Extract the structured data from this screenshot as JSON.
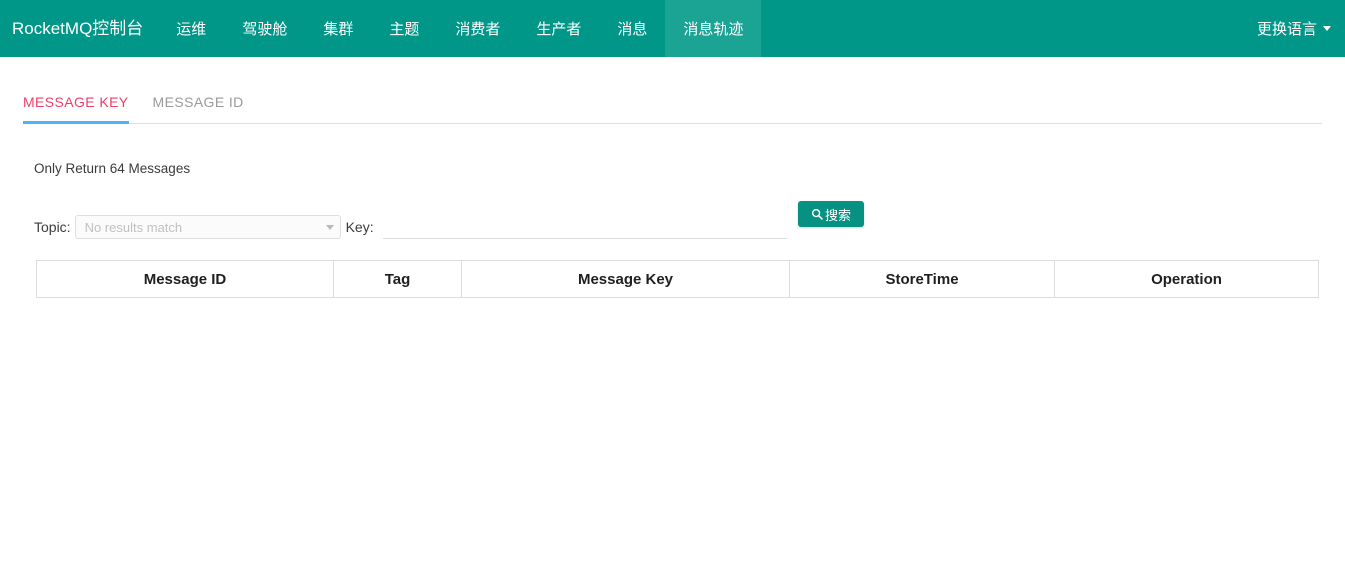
{
  "navbar": {
    "brand": "RocketMQ控制台",
    "items": [
      {
        "label": "运维",
        "active": false
      },
      {
        "label": "驾驶舱",
        "active": false
      },
      {
        "label": "集群",
        "active": false
      },
      {
        "label": "主题",
        "active": false
      },
      {
        "label": "消费者",
        "active": false
      },
      {
        "label": "生产者",
        "active": false
      },
      {
        "label": "消息",
        "active": false
      },
      {
        "label": "消息轨迹",
        "active": true
      }
    ],
    "language_label": "更换语言",
    "background_color": "#009688",
    "active_background_color": "#1ba394"
  },
  "tabs": [
    {
      "label": "MESSAGE KEY",
      "active": true
    },
    {
      "label": "MESSAGE ID",
      "active": false
    }
  ],
  "tab_active_color": "#ef3d68",
  "tab_underline_color": "#4bb4f5",
  "notice": "Only Return 64 Messages",
  "form": {
    "topic_label": "Topic:",
    "topic_value": "",
    "topic_placeholder": "No results match",
    "key_label": "Key:",
    "key_value": "",
    "key_placeholder": "",
    "search_label": "搜索",
    "search_button_color": "#079182"
  },
  "table": {
    "columns": [
      "Message ID",
      "Tag",
      "Message Key",
      "StoreTime",
      "Operation"
    ],
    "rows": []
  }
}
